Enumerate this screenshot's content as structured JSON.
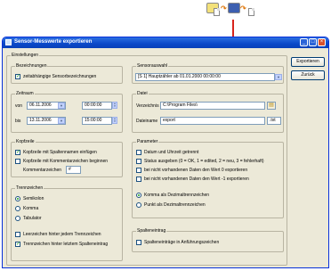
{
  "window": {
    "title": "Sensor-Messwerte exportieren",
    "minimize": "_",
    "maximize": "□",
    "close": "×"
  },
  "buttons": {
    "export": "Exportieren",
    "back": "Zurück"
  },
  "settings": {
    "label": "Einstellungen",
    "bezeichnungen": {
      "label": "Bezeichnungen",
      "option": "zeitabhängige Sensorbezeichnungen",
      "checked": true
    },
    "zeitraum": {
      "label": "Zeitraum",
      "from_label": "von",
      "from_date": "06.11.2006",
      "from_time": "00:00:00",
      "to_label": "bis",
      "to_date": "13.11.2006",
      "to_time": "15:00:00"
    },
    "kopfzeile": {
      "label": "Kopfzeile",
      "opt1": "Kopfzeile mit Spaltennamen einfügen",
      "opt1_checked": true,
      "opt2": "Kopfzeile mit Kommentarzeichen beginnen",
      "opt2_checked": false,
      "comment_label": "Kommentarzeichen",
      "comment_value": "#"
    },
    "trennzeichen": {
      "label": "Trennzeichen",
      "options": [
        "Semikolon",
        "Komma",
        "Tabulator"
      ],
      "selected": "Semikolon",
      "opt_empty": "Leerzeichen hinter jedem Trennzeichen",
      "opt_empty_checked": false,
      "opt_last": "Trennzeichen hinter letztem Spalteneintrag",
      "opt_last_checked": true
    },
    "sensorauswahl": {
      "label": "Sensorauswahl",
      "value": "[S 1]  Hauptzähler                                ab 01.01.2000  00:00:00"
    },
    "datei": {
      "label": "Datei",
      "dir_label": "Verzeichnis",
      "dir_value": "C:\\Program Files\\",
      "name_label": "Dateiname",
      "name_value": "export",
      "ext_value": ".txt"
    },
    "parameter": {
      "label": "Parameter",
      "opt1": "Datum und Uhrzeit getrennt",
      "opt2": "Status ausgeben (0 = OK, 1 = edited, 2 = neu, 3 = fehlerhaft)",
      "opt3": "bei nicht vorhandenen Daten den Wert 0 exportieren",
      "opt4": "bei nicht vorhandenen Daten den Wert -1 exportieren",
      "radio1": "Komma als Dezimaltrennzeichen",
      "radio2": "Punkt als Dezimaltrennzeichen",
      "radio_selected": "Komma als Dezimaltrennzeichen"
    },
    "spalteneintrag": {
      "label": "Spalteneintrag",
      "option": "Spalteneinträge in Anführungszeichen",
      "checked": false
    }
  },
  "colors": {
    "titlebar": "#0a48c9",
    "arrow": "#d8241c",
    "window_bg": "#ece9d8"
  },
  "icons": {
    "top_left": "sensor-app-icon",
    "top_right": "export-app-icon",
    "arrows": "orange-arrow-icon"
  }
}
